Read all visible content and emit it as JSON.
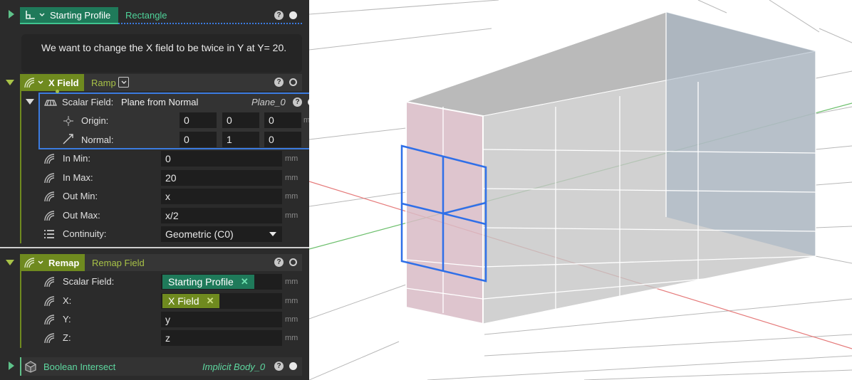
{
  "starting_profile": {
    "title": "Starting Profile",
    "type": "Rectangle"
  },
  "comment": {
    "text": "We want to change the X field to be twice in Y at Y= 20."
  },
  "x_field": {
    "title": "X Field",
    "type": "Ramp",
    "scalar_field": {
      "label": "Scalar Field:",
      "type": "Plane from Normal",
      "name": "Plane_0",
      "origin": {
        "label": "Origin:",
        "values": [
          "0",
          "0",
          "0"
        ],
        "unit": "mm"
      },
      "normal": {
        "label": "Normal:",
        "values": [
          "0",
          "1",
          "0"
        ]
      }
    },
    "in_min": {
      "label": "In Min:",
      "value": "0",
      "unit": "mm"
    },
    "in_max": {
      "label": "In Max:",
      "value": "20",
      "unit": "mm"
    },
    "out_min": {
      "label": "Out Min:",
      "value": "x",
      "unit": "mm"
    },
    "out_max": {
      "label": "Out Max:",
      "value": "x/2",
      "unit": "mm"
    },
    "continuity": {
      "label": "Continuity:",
      "value": "Geometric (C0)"
    }
  },
  "remap": {
    "title": "Remap",
    "type": "Remap Field",
    "scalar_field": {
      "label": "Scalar Field:",
      "chip": "Starting Profile",
      "unit": "mm"
    },
    "x": {
      "label": "X:",
      "chip": "X Field",
      "unit": "mm"
    },
    "y": {
      "label": "Y:",
      "value": "y",
      "unit": "mm"
    },
    "z": {
      "label": "Z:",
      "value": "z",
      "unit": "mm"
    }
  },
  "boolean": {
    "title": "Boolean Intersect",
    "name": "Implicit Body_0"
  },
  "colors": {
    "panel_bg": "#2b2b2b",
    "teal_header": "#1f7a5a",
    "olive_header": "#6f8a1f",
    "selection_blue": "#3b7be0",
    "link_green": "#5ec28a"
  },
  "icons": [
    "profile-icon",
    "field-icon",
    "plane-icon",
    "origin-icon",
    "normal-icon",
    "list-icon",
    "boolean-icon",
    "help-icon",
    "plus-icon"
  ]
}
